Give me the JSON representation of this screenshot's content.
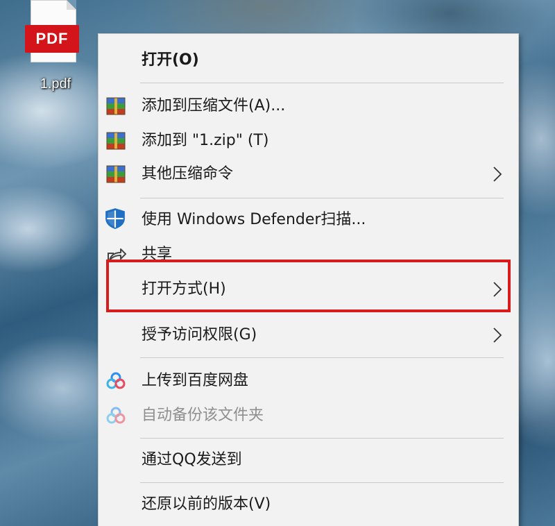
{
  "desktop": {
    "file_icon": {
      "badge_text": "PDF",
      "file_name": "1.pdf",
      "icon": "pdf-file-icon"
    }
  },
  "context_menu": {
    "items": [
      {
        "label": "打开(O)",
        "icon": null,
        "bold": true,
        "submenu": false,
        "disabled": false
      },
      {
        "label": "添加到压缩文件(A)...",
        "icon": "winrar-archive-icon",
        "bold": false,
        "submenu": false,
        "disabled": false
      },
      {
        "label": "添加到 \"1.zip\" (T)",
        "icon": "winrar-archive-icon",
        "bold": false,
        "submenu": false,
        "disabled": false
      },
      {
        "label": "其他压缩命令",
        "icon": "winrar-archive-icon",
        "bold": false,
        "submenu": true,
        "disabled": false
      },
      {
        "label": "使用 Windows Defender扫描...",
        "icon": "windows-defender-shield-icon",
        "bold": false,
        "submenu": false,
        "disabled": false
      },
      {
        "label": "共享",
        "icon": "share-icon",
        "bold": false,
        "submenu": false,
        "disabled": false
      },
      {
        "label": "打开方式(H)",
        "icon": null,
        "bold": false,
        "submenu": true,
        "disabled": false,
        "highlighted": true
      },
      {
        "label": "授予访问权限(G)",
        "icon": null,
        "bold": false,
        "submenu": true,
        "disabled": false
      },
      {
        "label": "上传到百度网盘",
        "icon": "baidu-netdisk-icon",
        "bold": false,
        "submenu": false,
        "disabled": false
      },
      {
        "label": "自动备份该文件夹",
        "icon": "baidu-netdisk-icon",
        "bold": false,
        "submenu": false,
        "disabled": true
      },
      {
        "label": "通过QQ发送到",
        "icon": null,
        "bold": false,
        "submenu": false,
        "disabled": false
      },
      {
        "label": "还原以前的版本(V)",
        "icon": null,
        "bold": false,
        "submenu": false,
        "disabled": false
      }
    ]
  },
  "colors": {
    "menu_background": "#f2f2f2",
    "highlight_border": "#d81b1b",
    "pdf_badge": "#d3141b",
    "disabled_text": "#8f8f8f",
    "defender_blue": "#1f6fc4",
    "baidu_blue": "#2b8ff0"
  }
}
